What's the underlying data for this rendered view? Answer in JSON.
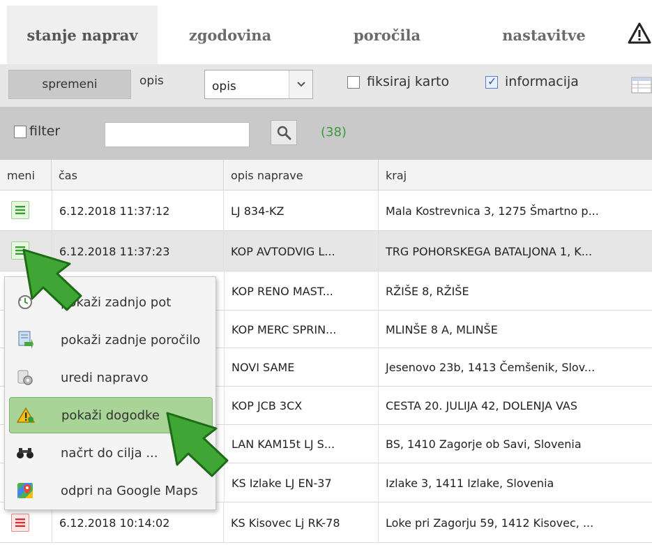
{
  "tabs": [
    {
      "label": "stanje naprav",
      "active": true
    },
    {
      "label": "zgodovina",
      "active": false
    },
    {
      "label": "poročila",
      "active": false
    },
    {
      "label": "nastavitve",
      "active": false
    }
  ],
  "toolbar": {
    "change_button": "spremeni",
    "description_label": "opis",
    "description_select_value": "opis",
    "fix_map": {
      "label": "fiksiraj karto",
      "checked": false
    },
    "information": {
      "label": "informacija",
      "checked": true
    }
  },
  "filter": {
    "label": "filter",
    "checked": false,
    "input_value": "",
    "count": "(38)"
  },
  "table": {
    "headers": [
      "meni",
      "čas",
      "opis naprave",
      "kraj"
    ],
    "rows": [
      {
        "time": "6.12.2018 11:37:12",
        "device": "LJ 834-KZ",
        "place": "Mala Kostrevnica 3, 1275 Šmartno p...",
        "status": "green"
      },
      {
        "time": "6.12.2018 11:37:23",
        "device": "KOP AVTODVIG L...",
        "place": "TRG POHORSKEGA BATALJONA 1, K...",
        "status": "green"
      },
      {
        "time": "",
        "device": "KOP RENO MAST...",
        "place": "RŽIŠE 8, RŽIŠE",
        "status": ""
      },
      {
        "time": "",
        "device": "KOP MERC SPRIN...",
        "place": "MLINŠE 8 A, MLINŠE",
        "status": ""
      },
      {
        "time": "",
        "device": "NOVI SAME",
        "place": "Jesenovo 23b, 1413 Čemšenik, Slov...",
        "status": ""
      },
      {
        "time": "",
        "device": "KOP JCB 3CX",
        "place": "CESTA 20. JULIJA 42, DOLENJA VAS",
        "status": ""
      },
      {
        "time": "",
        "device": "LAN KAM15t LJ S...",
        "place": "BS, 1410 Zagorje ob Savi, Slovenia",
        "status": ""
      },
      {
        "time": "",
        "device": "KS Izlake LJ EN-37",
        "place": "Izlake 3, 1411 Izlake, Slovenia",
        "status": ""
      },
      {
        "time": "6.12.2018 10:14:02",
        "device": "KS Kisovec Lj RK-78",
        "place": "Loke pri Zagorju 59, 1412 Kisovec, ...",
        "status": "red"
      }
    ]
  },
  "context_menu": {
    "items": [
      {
        "label": "pokaži zadnjo pot",
        "icon": "history-clock-icon"
      },
      {
        "label": "pokaži zadnje poročilo",
        "icon": "report-icon"
      },
      {
        "label": "uredi napravo",
        "icon": "device-settings-icon"
      },
      {
        "label": "pokaži dogodke",
        "icon": "warning-events-icon"
      },
      {
        "label": "načrt do cilja ...",
        "icon": "binoculars-icon"
      },
      {
        "label": "odpri na Google Maps",
        "icon": "google-maps-icon"
      }
    ]
  },
  "colors": {
    "tab_active_bg": "#efefef",
    "toolbar_bg": "#e7e7e7",
    "filterbar_bg": "#c9c9c9",
    "count_green": "#3a9a3a",
    "menu_hover": "#a9d497",
    "cursor_green": "#3fa534"
  }
}
